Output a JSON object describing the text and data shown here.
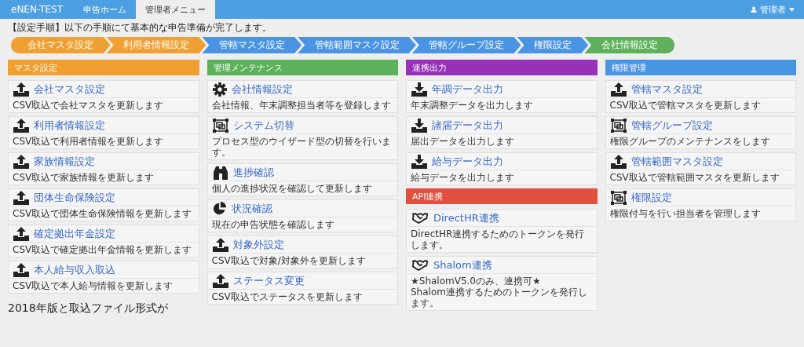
{
  "navbar": {
    "brand": "eNEN-TEST",
    "tabs": [
      {
        "label": "申告ホーム",
        "selected": false
      },
      {
        "label": "管理者メニュー",
        "selected": true
      }
    ],
    "user": "管理者"
  },
  "intro": "【設定手順】以下の手順にて基本的な申告準備が完了します。",
  "steps": [
    {
      "label": "会社マスタ設定",
      "color": "#f0a032"
    },
    {
      "label": "利用者情報設定",
      "color": "#f0a032"
    },
    {
      "label": "管轄マスタ設定",
      "color": "#4a94e4"
    },
    {
      "label": "管轄範囲マスク設定",
      "color": "#4a94e4"
    },
    {
      "label": "管轄グループ設定",
      "color": "#4a94e4"
    },
    {
      "label": "権限設定",
      "color": "#4a94e4"
    },
    {
      "label": "会社情報設定",
      "color": "#5cb15a"
    }
  ],
  "columns": [
    {
      "sections": [
        {
          "title": "マスタ設定",
          "color": "#f0a032",
          "cards": [
            {
              "kind": "upload",
              "title": "会社マスタ設定",
              "description": "CSV取込で会社マスタを更新します"
            },
            {
              "kind": "upload",
              "title": "利用者情報設定",
              "description": "CSV取込で利用者情報を更新します"
            },
            {
              "kind": "upload",
              "title": "家族情報設定",
              "description": "CSV取込で家族情報を更新します"
            },
            {
              "kind": "upload",
              "title": "団体生命保険設定",
              "description": "CSV取込で団体生命保険情報を更新します"
            },
            {
              "kind": "upload",
              "title": "確定拠出年金設定",
              "description": "CSV取込で確定拠出年金情報を更新します"
            },
            {
              "kind": "upload",
              "title": "本人給与収入取込",
              "description": "CSV取込で本人給与情報を更新します"
            }
          ]
        }
      ],
      "note": "2018年版と取込ファイル形式が"
    },
    {
      "sections": [
        {
          "title": "管理メンテナンス",
          "color": "#5cb15a",
          "cards": [
            {
              "kind": "gear",
              "title": "会社情報設定",
              "description": "会社情報、年末調整担当者等を登録します"
            },
            {
              "kind": "frame",
              "title": "システム切替",
              "description": "プロセス型のウイザード型の切替を行います。"
            },
            {
              "kind": "binoculars",
              "title": "進捗確認",
              "description": "個人の進捗状況を確認して更新します"
            },
            {
              "kind": "pie",
              "title": "状況確認",
              "description": "現在の申告状態を確認します"
            },
            {
              "kind": "upload",
              "title": "対象外設定",
              "description": "CSV取込で対象/対象外を更新します"
            },
            {
              "kind": "upload",
              "title": "ステータス変更",
              "description": "CSV取込でステータスを更新します"
            }
          ]
        }
      ]
    },
    {
      "sections": [
        {
          "title": "連携出力",
          "color": "#9631b8",
          "cards": [
            {
              "kind": "download",
              "title": "年調データ出力",
              "description": "年末調整データを出力します"
            },
            {
              "kind": "download",
              "title": "諸届データ出力",
              "description": "届出データを出力します"
            },
            {
              "kind": "download",
              "title": "給与データ出力",
              "description": "給与データを出力します"
            }
          ]
        },
        {
          "title": "API連携",
          "color": "#e2503f",
          "cards": [
            {
              "kind": "handshake",
              "title": "DirectHR連携",
              "description": "DirectHR連携するためのトークンを発行します。"
            },
            {
              "kind": "handshake",
              "title": "Shalom連携",
              "description": "★ShalomV5.0のみ、連携可★\nShalom連携するためのトークンを発行します。"
            }
          ]
        }
      ]
    },
    {
      "sections": [
        {
          "title": "権限管理",
          "color": "#4a94e4",
          "cards": [
            {
              "kind": "upload",
              "title": "管轄マスタ設定",
              "description": "CSV取込で管轄マスタを更新します"
            },
            {
              "kind": "frame",
              "title": "管轄グループ設定",
              "description": "権限グループのメンテナンスをします"
            },
            {
              "kind": "upload",
              "title": "管轄範囲マスタ設定",
              "description": "CSV取込で管轄範囲マスタを更新します"
            },
            {
              "kind": "frame",
              "title": "権限設定",
              "description": "権限付与を行い担当者を管理します"
            }
          ]
        }
      ]
    }
  ]
}
